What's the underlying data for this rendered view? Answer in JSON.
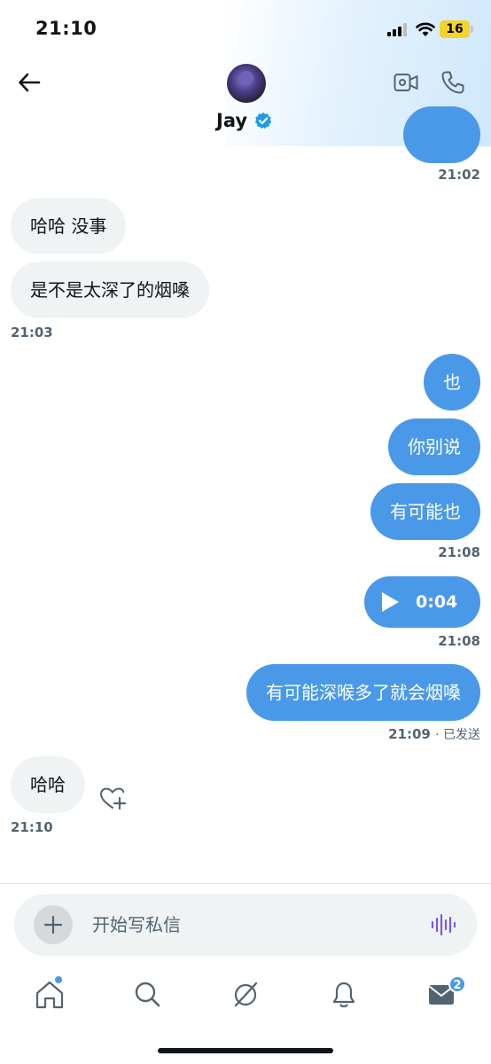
{
  "status_bar": {
    "time": "21:10",
    "battery": "16"
  },
  "header": {
    "contact_name": "Jay"
  },
  "messages": {
    "ts_prev": "21:02",
    "in1": "哈哈 没事",
    "in2": "是不是太深了的烟嗓",
    "ts_in": "21:03",
    "out1": "也",
    "out2": "你别说",
    "out3": "有可能也",
    "ts_out": "21:08",
    "voice_duration": "0:04",
    "ts_voice": "21:08",
    "out4": "有可能深喉多了就会烟嗓",
    "ts_sent": "21:09",
    "sent_status": "· 已发送",
    "in3": "哈哈",
    "ts_last": "21:10"
  },
  "composer": {
    "placeholder": "开始写私信"
  },
  "tabbar": {
    "messages_badge": "2"
  },
  "colors": {
    "accent": "#4a99e9",
    "incoming_bubble": "#eff3f4",
    "muted": "#536471",
    "voice_purple": "#7b5bd6"
  },
  "icons": [
    "back-arrow-icon",
    "verified-badge-icon",
    "video-call-icon",
    "phone-call-icon",
    "play-icon",
    "heart-plus-icon",
    "plus-icon",
    "voice-wave-icon",
    "home-icon",
    "search-icon",
    "grok-icon",
    "bell-icon",
    "mail-icon"
  ]
}
